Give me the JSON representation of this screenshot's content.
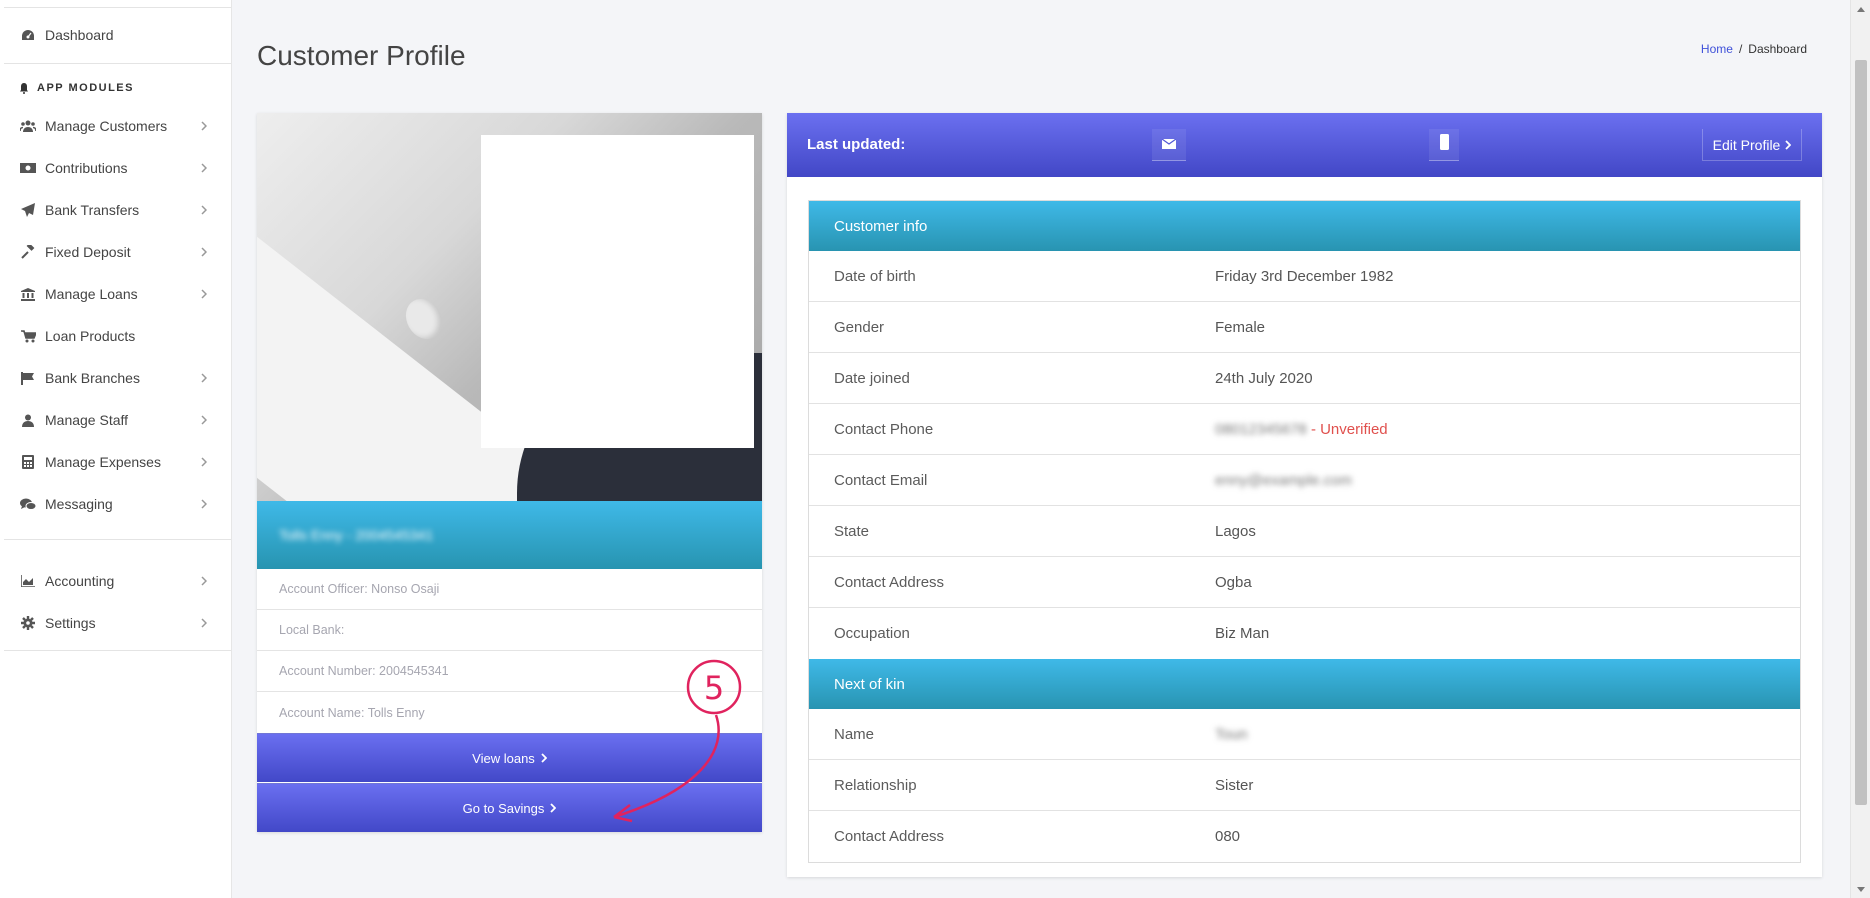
{
  "sidebar": {
    "dashboard": {
      "label": "Dashboard",
      "icon": "dashboard-icon"
    },
    "section_title": "APP MODULES",
    "items": [
      {
        "label": "Manage Customers",
        "icon": "users-icon"
      },
      {
        "label": "Contributions",
        "icon": "money-icon"
      },
      {
        "label": "Bank Transfers",
        "icon": "paper-plane-icon"
      },
      {
        "label": "Fixed Deposit",
        "icon": "gavel-icon"
      },
      {
        "label": "Manage Loans",
        "icon": "bank-icon"
      },
      {
        "label": "Loan Products",
        "icon": "cart-icon"
      },
      {
        "label": "Bank Branches",
        "icon": "flag-icon"
      },
      {
        "label": "Manage Staff",
        "icon": "user-icon"
      },
      {
        "label": "Manage Expenses",
        "icon": "calculator-icon"
      },
      {
        "label": "Messaging",
        "icon": "comments-icon"
      }
    ],
    "bottom_items": [
      {
        "label": "Accounting",
        "icon": "area-chart-icon"
      },
      {
        "label": "Settings",
        "icon": "cog-icon"
      }
    ]
  },
  "header": {
    "title": "Customer Profile",
    "breadcrumb": {
      "home": "Home",
      "separator": "/",
      "current": "Dashboard"
    }
  },
  "profile_card": {
    "name_line": "Tolls Enny - 2004545341",
    "info_rows": [
      "Account Officer: Nonso Osaji",
      "Local Bank:",
      "Account Number: 2004545341",
      "Account Name: Tolls Enny"
    ],
    "buttons": {
      "view_loans": "View loans",
      "go_to_savings": "Go to Savings"
    }
  },
  "detail_panel": {
    "last_updated_label": "Last updated:",
    "edit_profile": "Edit Profile",
    "customer_info_title": "Customer info",
    "customer_info": [
      {
        "label": "Date of birth",
        "value": "Friday 3rd December 1982"
      },
      {
        "label": "Gender",
        "value": "Female"
      },
      {
        "label": "Date joined",
        "value": "24th July 2020"
      },
      {
        "label": "Contact Phone",
        "value": "08012345678",
        "status": "- Unverified"
      },
      {
        "label": "Contact Email",
        "value": "enny@example.com"
      },
      {
        "label": "State",
        "value": "Lagos"
      },
      {
        "label": "Contact Address",
        "value": "Ogba"
      },
      {
        "label": "Occupation",
        "value": "Biz Man"
      }
    ],
    "next_of_kin_title": "Next of kin",
    "next_of_kin": [
      {
        "label": "Name",
        "value": "Toun"
      },
      {
        "label": "Relationship",
        "value": "Sister"
      },
      {
        "label": "Contact Address",
        "value": "080"
      }
    ]
  },
  "annotation": {
    "step_number": "5",
    "color": "#e0235e"
  },
  "colors": {
    "header_gradient_top": "#6b70f0",
    "header_gradient_bottom": "#4247c6",
    "section_gradient_top": "#3fb9e8",
    "section_gradient_bottom": "#2894b1",
    "unverified": "#e0504d",
    "link": "#3f51d9"
  }
}
